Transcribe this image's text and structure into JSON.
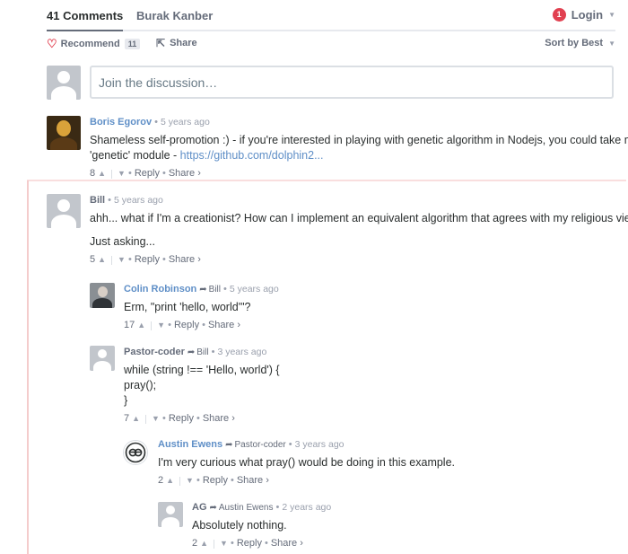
{
  "header": {
    "comments_tab": "41 Comments",
    "site_tab": "Burak Kanber",
    "login": "Login",
    "notification_count": "1"
  },
  "toolbar": {
    "recommend": "Recommend",
    "recommend_count": "11",
    "share": "Share",
    "sort": "Sort by Best"
  },
  "composer": {
    "placeholder": "Join the discussion…"
  },
  "comments": [
    {
      "author": "Boris Egorov",
      "time": "5 years ago",
      "lines": [
        "Shameless self-promotion :) - if you're interested in playing with genetic algorithm in Nodejs, you could take my",
        "'genetic' module - "
      ],
      "link": "https://github.com/dolphin2...",
      "votes": "8",
      "reply": "Reply",
      "share": "Share ›"
    },
    {
      "author": "Bill",
      "time": "5 years ago",
      "line1": "ahh... what if I'm a creationist? How can I implement an equivalent algorithm that agrees with my religious views?",
      "line2": "Just asking...",
      "votes": "5",
      "reply": "Reply",
      "share": "Share ›"
    },
    {
      "author": "Colin Robinson",
      "parent": "Bill",
      "time": "5 years ago",
      "line1": "Erm, \"print 'hello, world'\"?",
      "votes": "17",
      "reply": "Reply",
      "share": "Share ›"
    },
    {
      "author": "Pastor-coder",
      "parent": "Bill",
      "time": "3 years ago",
      "line1": "while (string !== 'Hello, world') {",
      "line2": "pray();",
      "line3": "}",
      "votes": "7",
      "reply": "Reply",
      "share": "Share ›"
    },
    {
      "author": "Austin Ewens",
      "parent": "Pastor-coder",
      "time": "3 years ago",
      "line1": "I'm very curious what pray() would be doing in this example.",
      "votes": "2",
      "reply": "Reply",
      "share": "Share ›"
    },
    {
      "author": "AG",
      "parent": "Austin Ewens",
      "time": "2 years ago",
      "line1": "Absolutely nothing.",
      "votes": "2",
      "reply": "Reply",
      "share": "Share ›"
    }
  ],
  "colors": {
    "link": "#5f8fc7",
    "badge": "#e14050",
    "thread_line": "#f4cccc"
  }
}
